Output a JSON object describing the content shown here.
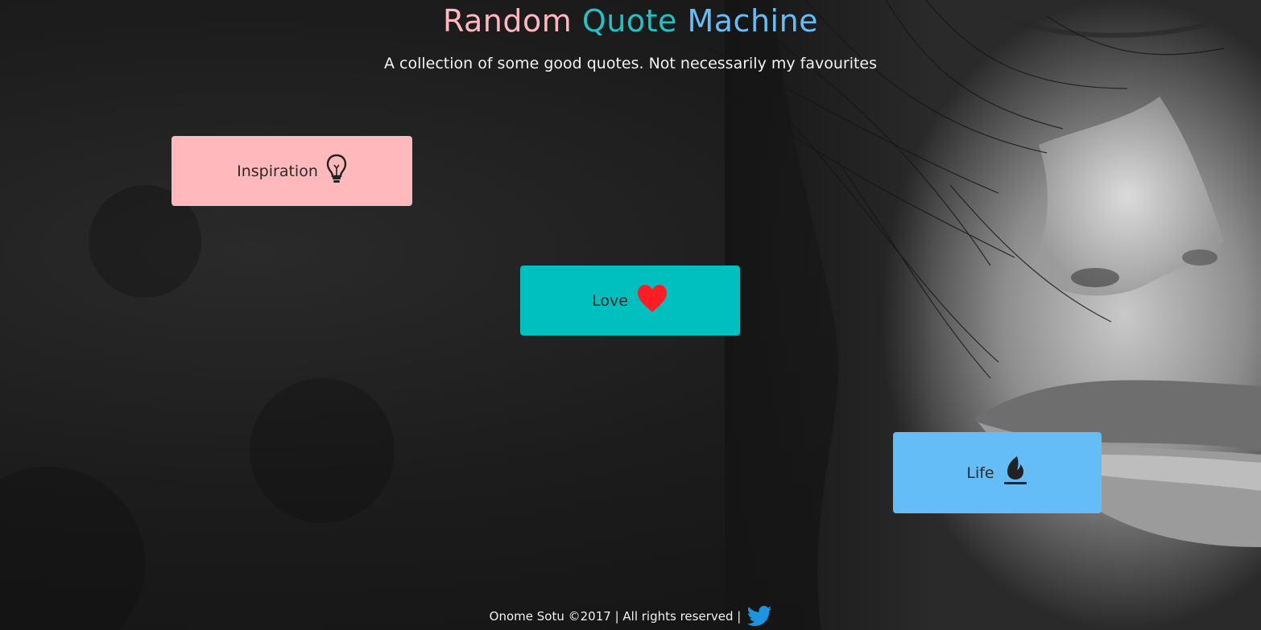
{
  "header": {
    "title_word_1": "Random",
    "title_word_2": "Quote",
    "title_word_3": "Machine",
    "subtitle": "A collection of some good quotes. Not necessarily my favourites"
  },
  "categories": [
    {
      "label": "Inspiration",
      "icon": "lightbulb-icon",
      "color": "#ffb8bb"
    },
    {
      "label": "Love",
      "icon": "heart-icon",
      "color": "#00bfbf"
    },
    {
      "label": "Life",
      "icon": "flame-icon",
      "color": "#64bdf6"
    }
  ],
  "footer": {
    "text": "Onome Sotu ©2017 | All rights reserved |",
    "icon": "twitter-icon"
  },
  "colors": {
    "title_1": "#ffb8bf",
    "title_2": "#21c1c6",
    "title_3": "#67bdf5",
    "twitter": "#1b95e0",
    "heart": "#ff1d25"
  }
}
